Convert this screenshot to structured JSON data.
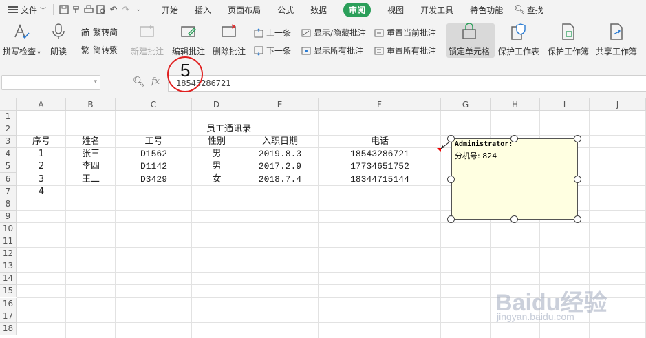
{
  "menubar": {
    "file_label": "文件",
    "tabs": [
      "开始",
      "插入",
      "页面布局",
      "公式",
      "数据",
      "审阅",
      "视图",
      "开发工具",
      "特色功能"
    ],
    "active_tab": "审阅",
    "search_label": "查找"
  },
  "ribbon": {
    "spell_check": "拼写检查",
    "read_aloud": "朗读",
    "trad_to_simp": "繁转简",
    "simp_to_trad": "简转繁",
    "new_comment": "新建批注",
    "edit_comment": "编辑批注",
    "delete_comment": "删除批注",
    "prev_comment": "上一条",
    "next_comment": "下一条",
    "show_hide_comment": "显示/隐藏批注",
    "show_all_comments": "显示所有批注",
    "reset_current_comment": "重置当前批注",
    "reset_all_comments": "重置所有批注",
    "lock_cell": "锁定单元格",
    "protect_sheet": "保护工作表",
    "protect_workbook": "保护工作簿",
    "share_workbook": "共享工作簿"
  },
  "formula_bar": {
    "name_box": "",
    "fx_label": "fx",
    "value": "18543286721"
  },
  "annotation": {
    "step_number": "5"
  },
  "grid": {
    "columns": [
      "A",
      "B",
      "C",
      "D",
      "E",
      "F",
      "G",
      "H",
      "I",
      "J"
    ],
    "rows": [
      "1",
      "2",
      "3",
      "4",
      "5",
      "6",
      "7",
      "8",
      "9",
      "10",
      "11",
      "12",
      "13",
      "14",
      "15",
      "16",
      "17",
      "18"
    ],
    "title": "员工通讯录",
    "headers": [
      "序号",
      "姓名",
      "工号",
      "性别",
      "入职日期",
      "电话"
    ],
    "data": [
      [
        "1",
        "张三",
        "D1562",
        "男",
        "2019.8.3",
        "18543286721"
      ],
      [
        "2",
        "李四",
        "D1142",
        "男",
        "2017.2.9",
        "17734651752"
      ],
      [
        "3",
        "王二",
        "D3429",
        "女",
        "2018.7.4",
        "18344715144"
      ],
      [
        "4",
        "",
        "",
        "",
        "",
        ""
      ]
    ]
  },
  "comment": {
    "author": "Administrator:",
    "text": "分机号: 824"
  },
  "watermark": {
    "brand": "Baidu经验",
    "url": "jingyan.baidu.com"
  }
}
